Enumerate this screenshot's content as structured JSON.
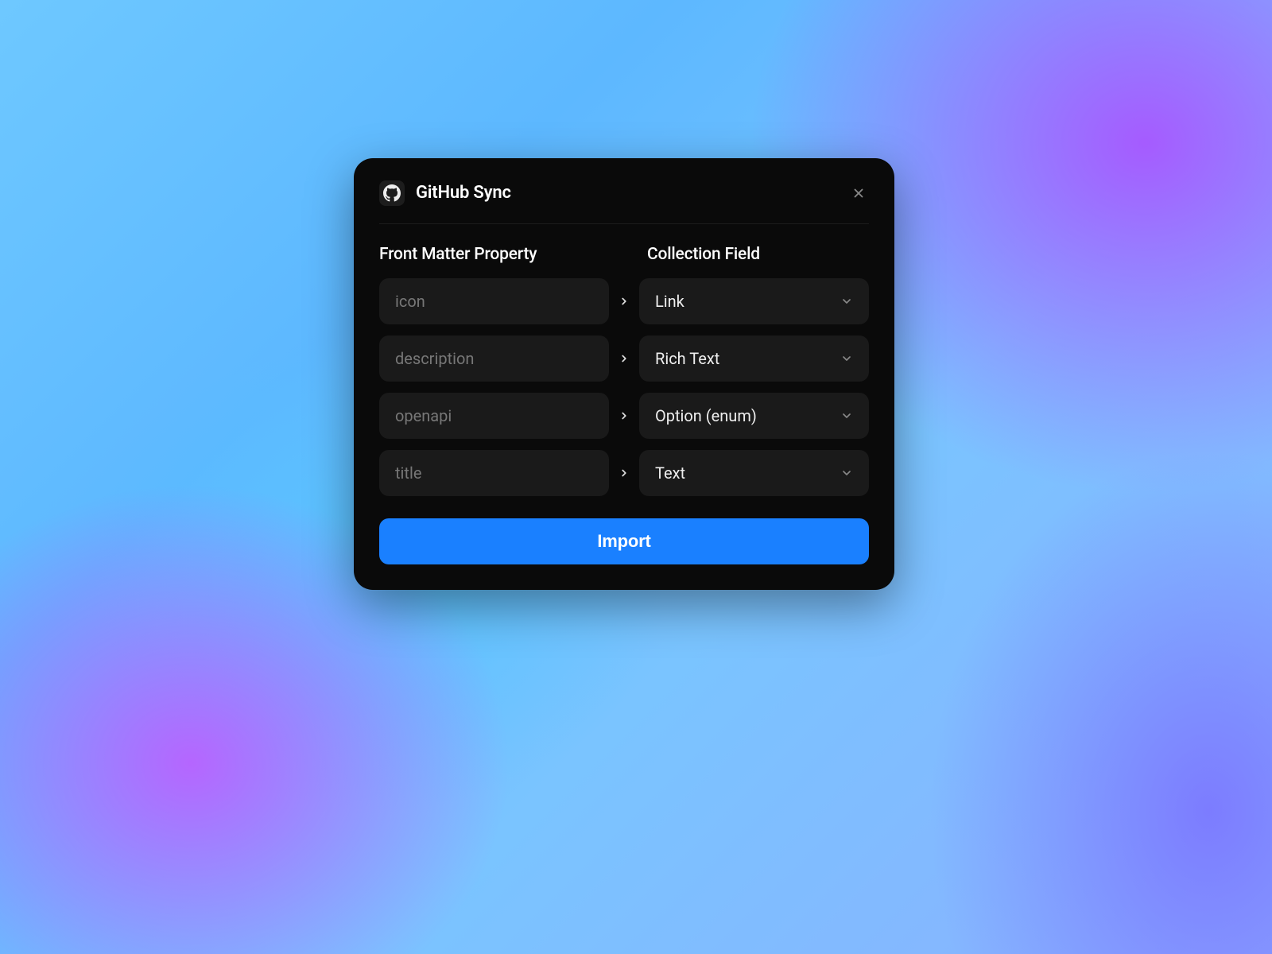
{
  "modal": {
    "title": "GitHub Sync",
    "columns": {
      "left": "Front Matter Property",
      "right": "Collection Field"
    },
    "rows": [
      {
        "property": "icon",
        "field": "Link"
      },
      {
        "property": "description",
        "field": "Rich Text"
      },
      {
        "property": "openapi",
        "field": "Option (enum)"
      },
      {
        "property": "title",
        "field": "Text"
      }
    ],
    "import_label": "Import"
  }
}
